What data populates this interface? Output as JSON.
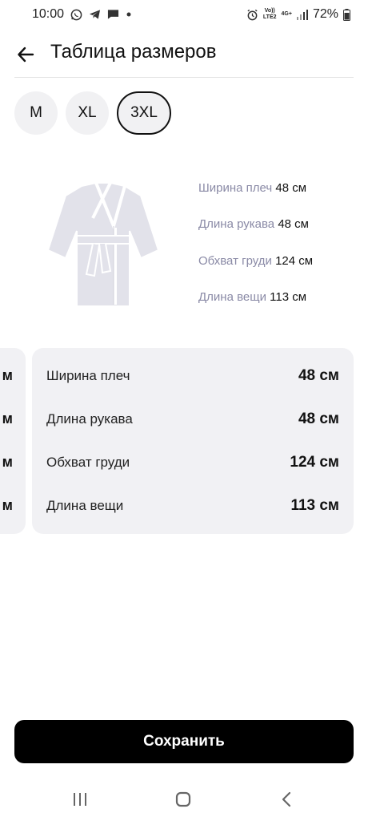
{
  "status_bar": {
    "time": "10:00",
    "left_icons": [
      "whatsapp-icon",
      "telegram-icon",
      "message-icon",
      "dot-icon"
    ],
    "network_top": "Vo))",
    "network_bottom": "LTE2",
    "signal_type": "4G+",
    "battery": "72%"
  },
  "header": {
    "title": "Таблица размеров",
    "back_icon": "arrow-left-icon"
  },
  "sizes": [
    {
      "label": "M",
      "selected": false
    },
    {
      "label": "XL",
      "selected": false
    },
    {
      "label": "3XL",
      "selected": true
    }
  ],
  "illustration": {
    "icon": "bathrobe-icon",
    "measures": [
      {
        "label": "Ширина плеч",
        "value": "48 см"
      },
      {
        "label": "Длина рукава",
        "value": "48 см"
      },
      {
        "label": "Обхват груди",
        "value": "124 см"
      },
      {
        "label": "Длина вещи",
        "value": "113 см"
      }
    ]
  },
  "prev_card": {
    "values": [
      "м",
      "м",
      "м",
      "м"
    ]
  },
  "main_card": {
    "rows": [
      {
        "label": "Ширина плеч",
        "value": "48 см"
      },
      {
        "label": "Длина рукава",
        "value": "48 см"
      },
      {
        "label": "Обхват груди",
        "value": "124 см"
      },
      {
        "label": "Длина вещи",
        "value": "113 см"
      }
    ]
  },
  "save_button": {
    "label": "Сохранить"
  },
  "nav_bar": {
    "icons": [
      "recents-icon",
      "home-icon",
      "back-icon"
    ]
  },
  "colors": {
    "accent": "#000000",
    "card_bg": "#f1f1f4",
    "chip_bg": "#f1f1f3",
    "muted_label": "#8a8aa6"
  }
}
